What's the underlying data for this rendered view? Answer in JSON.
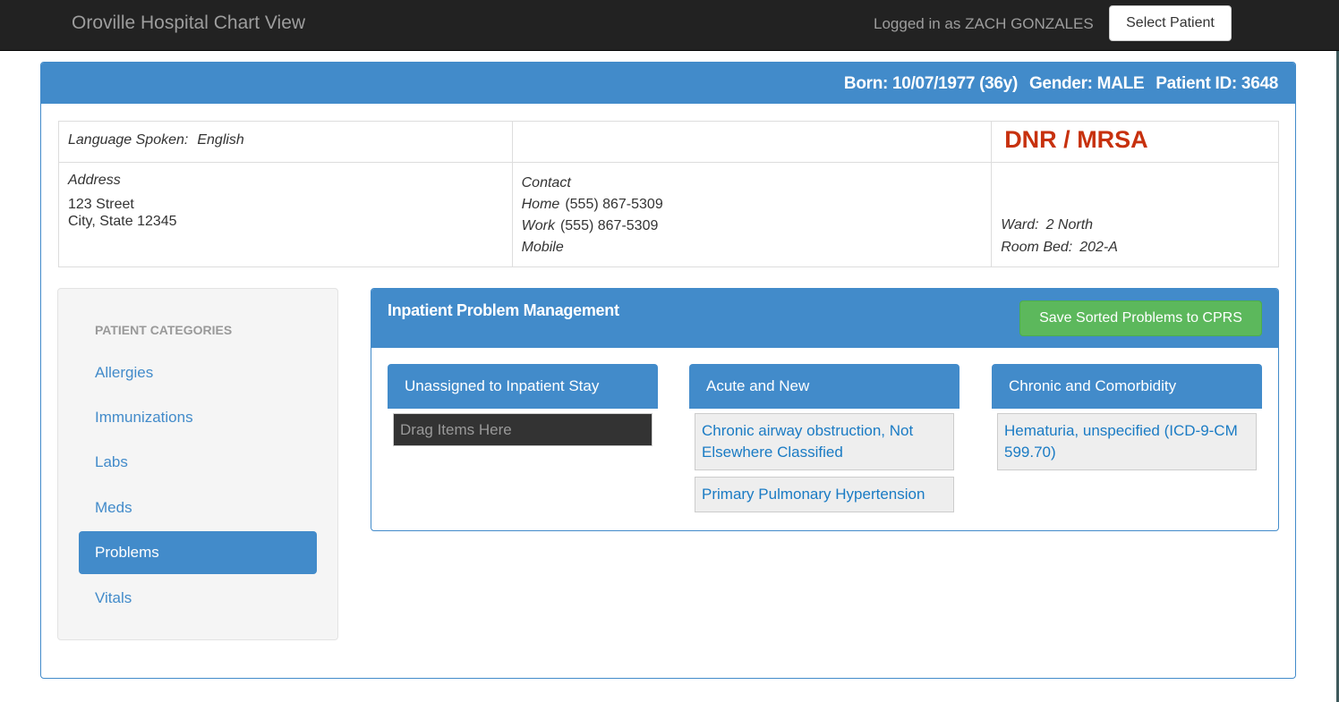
{
  "navbar": {
    "brand": "Oroville Hospital Chart View",
    "logged_in": "Logged in as ZACH GONZALES",
    "select_patient": "Select Patient"
  },
  "patient": {
    "born": "Born: 10/07/1977 (36y)",
    "gender": "Gender: MALE",
    "patient_id": "Patient ID: 3648",
    "language_label": "Language Spoken:",
    "language_value": "English",
    "alert": "DNR / MRSA",
    "address_label": "Address",
    "address_line1": "123 Street",
    "address_line2": "City, State 12345",
    "contact_label": "Contact",
    "home_label": "Home",
    "home_phone": "(555) 867-5309",
    "work_label": "Work",
    "work_phone": "(555) 867-5309",
    "mobile_label": "Mobile",
    "ward_label": "Ward:",
    "ward_value": "2 North",
    "room_label": "Room Bed:",
    "room_value": "202-A"
  },
  "sidebar": {
    "header": "PATIENT CATEGORIES",
    "items": [
      {
        "label": "Allergies",
        "active": false
      },
      {
        "label": "Immunizations",
        "active": false
      },
      {
        "label": "Labs",
        "active": false
      },
      {
        "label": "Meds",
        "active": false
      },
      {
        "label": "Problems",
        "active": true
      },
      {
        "label": "Vitals",
        "active": false
      }
    ]
  },
  "problem_management": {
    "title": "Inpatient Problem Management",
    "save_button": "Save Sorted Problems to CPRS",
    "columns": [
      {
        "title": "Unassigned to Inpatient Stay",
        "placeholder": "Drag Items Here",
        "items": []
      },
      {
        "title": "Acute and New",
        "items": [
          "Chronic airway obstruction, Not Elsewhere Classified",
          "Primary Pulmonary Hypertension"
        ]
      },
      {
        "title": "Chronic and Comorbidity",
        "items": [
          "Hematuria, unspecified (ICD-9-CM 599.70)"
        ]
      }
    ]
  },
  "colors": {
    "primary": "#428bca",
    "success": "#5cb85c",
    "alert": "#c7310e",
    "navbar": "#222222"
  }
}
